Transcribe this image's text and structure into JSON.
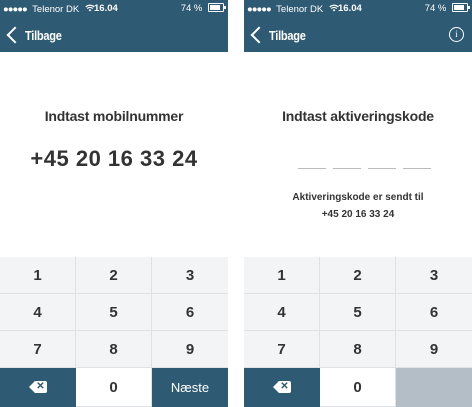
{
  "colors": {
    "header_bg": "#2f5a73",
    "keypad_bg": "#f3f4f5",
    "disabled_key": "#b4bec6",
    "text": "#333333"
  },
  "status_bar": {
    "signal": "●●●●●",
    "carrier": "Telenor DK",
    "time": "16.04",
    "battery": "74 %",
    "battery_level": 0.74
  },
  "nav": {
    "back_label": "Tilbage"
  },
  "screen_phone": {
    "title": "Indtast mobilnummer",
    "phone_number": "+45 20 16 33 24"
  },
  "screen_code": {
    "title": "Indtast aktiveringskode",
    "code_slots": 4,
    "sent_label": "Aktiveringskode er sendt til",
    "sent_number": "+45 20 16 33 24",
    "info_icon": "info-icon"
  },
  "keypad": {
    "digits": [
      "1",
      "2",
      "3",
      "4",
      "5",
      "6",
      "7",
      "8",
      "9"
    ],
    "zero": "0",
    "backspace_icon": "backspace-icon",
    "next_label": "Næste"
  }
}
